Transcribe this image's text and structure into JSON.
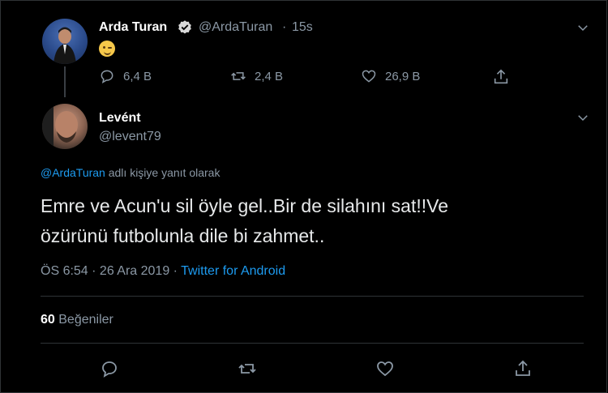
{
  "original_tweet": {
    "author_name": "Arda Turan",
    "author_handle": "@ArdaTuran",
    "separator": "·",
    "time": "15s",
    "reply_count": "6,4 B",
    "retweet_count": "2,4 B",
    "like_count": "26,9 B"
  },
  "reply_tweet": {
    "author_name": "Levént",
    "author_handle": "@levent79",
    "replying_to_mention": "@ArdaTuran",
    "replying_to_suffix": "adlı kişiye yanıt olarak",
    "text_line1": "Emre ve Acun'u sil öyle gel..Bir de silahını sat!!Ve",
    "text_line2": "özürünü futbolunla dile bi zahmet..",
    "timestamp": "ÖS 6:54 · 26 Ara 2019 ·",
    "source": "Twitter for Android",
    "like_total": "60",
    "like_label": "Beğeniler"
  },
  "colors": {
    "background": "#000000",
    "accent": "#1d9bf0",
    "muted": "#8b98a5",
    "divider": "#2f3336"
  }
}
